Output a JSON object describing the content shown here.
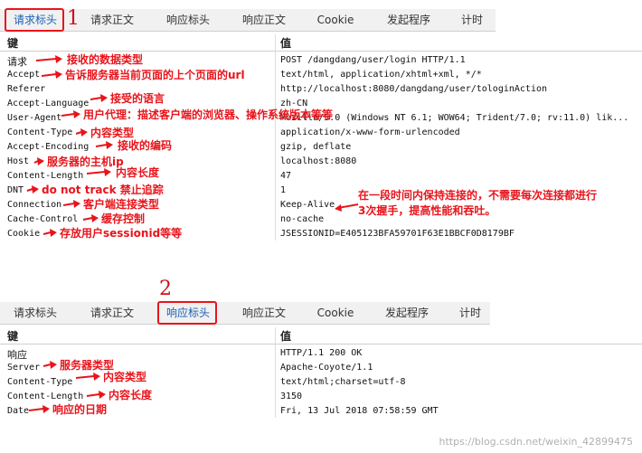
{
  "tabs": [
    "请求标头",
    "请求正文",
    "响应标头",
    "响应正文",
    "Cookie",
    "发起程序",
    "计时"
  ],
  "markers": {
    "first": "1",
    "second": "2"
  },
  "columns": {
    "key": "键",
    "value": "值"
  },
  "request": {
    "rows": [
      {
        "key": "请求",
        "value": "POST /dangdang/user/login HTTP/1.1",
        "note": "接收的数据类型"
      },
      {
        "key": "Accept",
        "value": "text/html, application/xhtml+xml, */*",
        "note": "告诉服务器当前页面的上个页面的url"
      },
      {
        "key": "Referer",
        "value": "http://localhost:8080/dangdang/user/tologinAction",
        "note": ""
      },
      {
        "key": "Accept-Language",
        "value": "zh-CN",
        "note": "接受的语言"
      },
      {
        "key": "User-Agent",
        "value": "Mozilla/5.0 (Windows NT 6.1; WOW64; Trident/7.0; rv:11.0) lik...",
        "note": "用户代理：描述客户端的浏览器、操作系统版本等等"
      },
      {
        "key": "Content-Type",
        "value": "application/x-www-form-urlencoded",
        "note": "内容类型"
      },
      {
        "key": "Accept-Encoding",
        "value": "gzip, deflate",
        "note": "接收的编码"
      },
      {
        "key": "Host",
        "value": "localhost:8080",
        "note": "服务器的主机ip"
      },
      {
        "key": "Content-Length",
        "value": "47",
        "note": "内容长度"
      },
      {
        "key": "DNT",
        "value": "1",
        "note": "do not track 禁止追踪"
      },
      {
        "key": "Connection",
        "value": "Keep-Alive",
        "note": "客户端连接类型"
      },
      {
        "key": "Cache-Control",
        "value": "no-cache",
        "note": "缓存控制"
      },
      {
        "key": "Cookie",
        "value": "JSESSIONID=E405123BFA59701F63E1BBCF0D8179BF",
        "note": "存放用户sessionid等等"
      }
    ],
    "keepalive_note_line1": "在一段时间内保持连接的，不需要每次连接都进行",
    "keepalive_note_line2": "3次握手，提高性能和吞吐。"
  },
  "response": {
    "rows": [
      {
        "key": "响应",
        "value": "HTTP/1.1 200 OK",
        "note": ""
      },
      {
        "key": "Server",
        "value": "Apache-Coyote/1.1",
        "note": "服务器类型"
      },
      {
        "key": "Content-Type",
        "value": "text/html;charset=utf-8",
        "note": "内容类型"
      },
      {
        "key": "Content-Length",
        "value": "3150",
        "note": "内容长度"
      },
      {
        "key": "Date",
        "value": "Fri, 13 Jul 2018 07:58:59 GMT",
        "note": "响应的日期"
      }
    ]
  },
  "watermark": "https://blog.csdn.net/weixin_42899475",
  "colors": {
    "annotation": "#e8141b",
    "active_tab": "#1a5fb4"
  }
}
